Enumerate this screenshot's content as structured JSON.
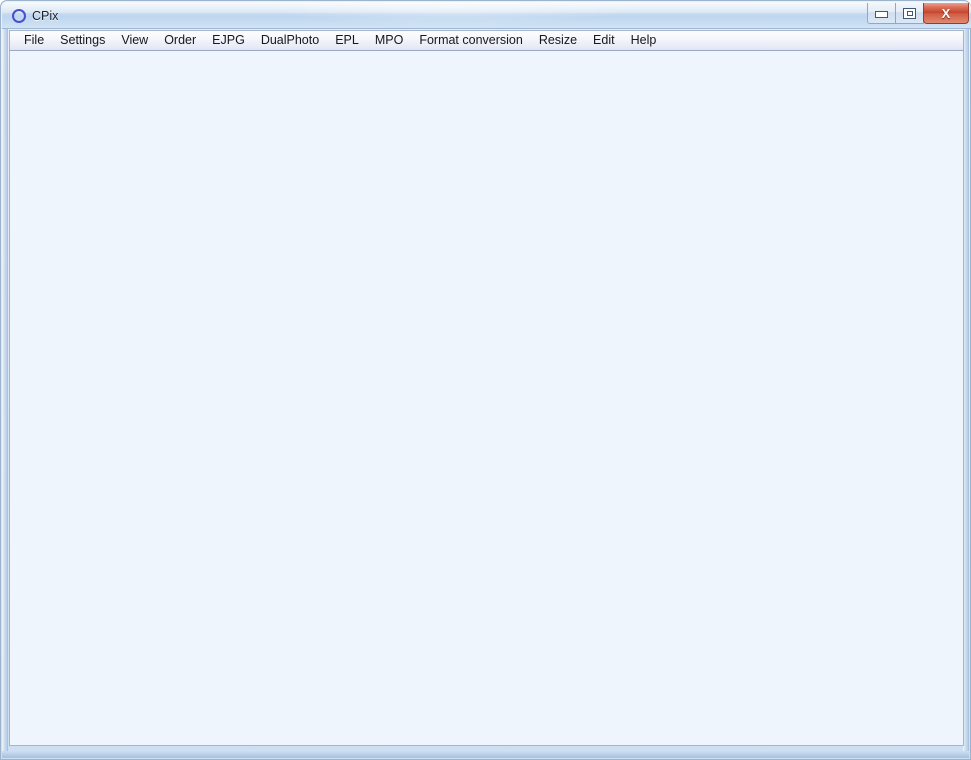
{
  "window": {
    "title": "CPix",
    "icon": "circle-icon",
    "accent_color": "#4a4ed0",
    "titlebar_color": "#c3daf1",
    "client_color": "#eff5fd",
    "close_button_color": "#c5452c"
  },
  "titlebar_buttons": [
    {
      "name": "minimize-button",
      "label": "Minimize",
      "icon": "minimize-icon"
    },
    {
      "name": "maximize-button",
      "label": "Maximize",
      "icon": "maximize-icon"
    },
    {
      "name": "close-button",
      "label": "Close",
      "icon": "close-icon",
      "glyph": "X"
    }
  ],
  "menubar": {
    "items": [
      {
        "label": "File"
      },
      {
        "label": "Settings"
      },
      {
        "label": "View"
      },
      {
        "label": "Order"
      },
      {
        "label": "EJPG"
      },
      {
        "label": "DualPhoto"
      },
      {
        "label": "EPL"
      },
      {
        "label": "MPO"
      },
      {
        "label": "Format conversion"
      },
      {
        "label": "Resize"
      },
      {
        "label": "Edit"
      },
      {
        "label": "Help"
      }
    ]
  },
  "client": {
    "content": ""
  }
}
